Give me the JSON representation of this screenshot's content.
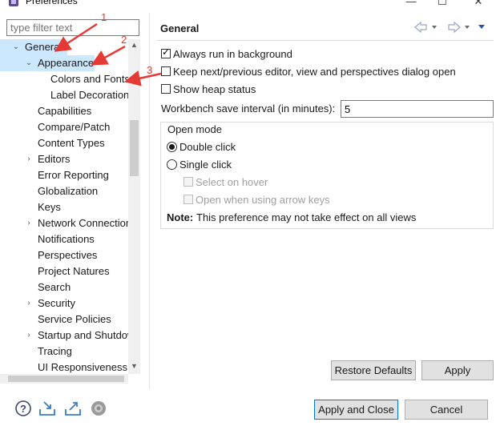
{
  "window": {
    "title": "Preferences",
    "controls": {
      "minimize": "—",
      "maximize": "☐",
      "close": "✕"
    }
  },
  "filter": {
    "placeholder": "type filter text"
  },
  "tree": [
    {
      "label": "General",
      "twisty": "⌄",
      "selected": true
    },
    {
      "label": "Appearance",
      "twisty": "⌄",
      "selected": true
    },
    {
      "label": "Colors and Fonts"
    },
    {
      "label": "Label Decorations"
    },
    {
      "label": "Capabilities"
    },
    {
      "label": "Compare/Patch"
    },
    {
      "label": "Content Types"
    },
    {
      "label": "Editors",
      "twisty": "›"
    },
    {
      "label": "Error Reporting"
    },
    {
      "label": "Globalization"
    },
    {
      "label": "Keys"
    },
    {
      "label": "Network Connections",
      "twisty": "›"
    },
    {
      "label": "Notifications"
    },
    {
      "label": "Perspectives"
    },
    {
      "label": "Project Natures"
    },
    {
      "label": "Search"
    },
    {
      "label": "Security",
      "twisty": "›"
    },
    {
      "label": "Service Policies"
    },
    {
      "label": "Startup and Shutdown",
      "twisty": "›"
    },
    {
      "label": "Tracing"
    },
    {
      "label": "UI Responsiveness"
    }
  ],
  "page": {
    "title": "General",
    "always_run_bg": {
      "label": "Always run in background",
      "checked": true
    },
    "keep_next_prev": {
      "label": "Keep next/previous editor, view and perspectives dialog open",
      "checked": false
    },
    "show_heap": {
      "label": "Show heap status",
      "checked": false
    },
    "save_interval": {
      "label": "Workbench save interval (in minutes):",
      "value": "5"
    },
    "open_mode": {
      "title": "Open mode",
      "double_click": "Double click",
      "single_click": "Single click",
      "selected": "double_click",
      "select_on_hover": "Select on hover",
      "open_arrow_keys": "Open when using arrow keys"
    },
    "note": {
      "label": "Note:",
      "text": "This preference may not take effect on all views"
    }
  },
  "buttons": {
    "restore_defaults": "Restore Defaults",
    "apply": "Apply",
    "apply_and_close": "Apply and Close",
    "cancel": "Cancel"
  },
  "annotations": {
    "n1": "1",
    "n2": "2",
    "n3": "3",
    "color": "#e53935"
  },
  "colors": {
    "selection": "#cce8ff",
    "default_button_border": "#0078d7"
  }
}
